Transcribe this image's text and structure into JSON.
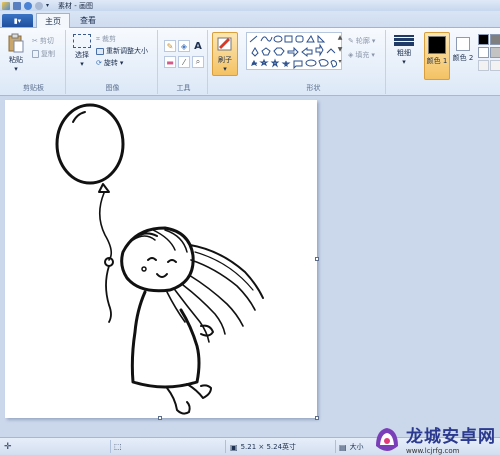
{
  "window": {
    "title": "素材 - 画图"
  },
  "tabs": {
    "file_label": "",
    "home": "主页",
    "view": "查看"
  },
  "clipboard": {
    "paste": "粘贴",
    "cut": "剪切",
    "copy": "复制",
    "label": "剪贴板"
  },
  "image": {
    "select": "选择",
    "crop": "裁剪",
    "resize": "重新调整大小",
    "rotate": "旋转",
    "label": "图像"
  },
  "tools": {
    "label": "工具"
  },
  "brushes": {
    "label": "刷子"
  },
  "shapes": {
    "outline": "轮廓",
    "fill": "填充",
    "label": "形状"
  },
  "size": {
    "label": "粗细"
  },
  "colors": {
    "color1": "颜色 1",
    "color2": "颜色 2",
    "palette": [
      "#000000",
      "#7f7f7f",
      "#ffffff",
      "#c3c3c3"
    ],
    "accent": "#f0b24a"
  },
  "status": {
    "image_size": "5.21 × 5.24英寸",
    "zoom": "大小"
  },
  "watermark": {
    "text": "龙城安卓网",
    "url": "www.lcjrfg.com"
  }
}
